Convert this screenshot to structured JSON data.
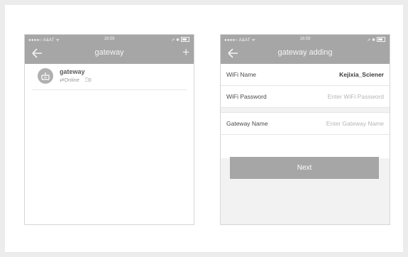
{
  "status_bar": {
    "carrier": "●●●●○ A&AT",
    "time": "16:59",
    "right": "➚ ✱"
  },
  "left_screen": {
    "title": "gateway",
    "add_symbol": "+",
    "device": {
      "name": "gateway",
      "status": "Online",
      "count": "0"
    }
  },
  "right_screen": {
    "title": "gateway adding",
    "wifi_name": {
      "label": "WiFi Name",
      "value": "Kejixia_Sciener"
    },
    "wifi_password": {
      "label": "WiFi Password",
      "placeholder": "Enter WiFi Password"
    },
    "gateway_name": {
      "label": "Gateway Name",
      "placeholder": "Enter Gateway Name"
    },
    "next_label": "Next"
  },
  "colors": {
    "header": "#a6a6a6",
    "button": "#a6a6a6",
    "background": "#ececec"
  },
  "icons": [
    "back-arrow-icon",
    "plus-icon",
    "wifi-icon",
    "battery-icon",
    "gateway-icon",
    "online-icon",
    "lock-count-icon"
  ]
}
